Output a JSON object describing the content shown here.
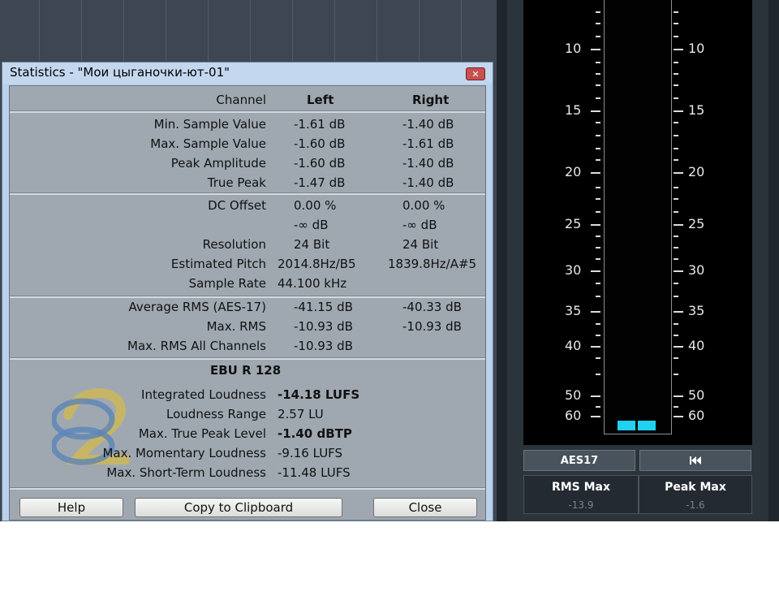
{
  "dialog": {
    "title": "Statistics - \"Мои цыганочки-ют-01\"",
    "close_icon": "close-x-icon",
    "header": {
      "channel": "Channel",
      "left": "Left",
      "right": "Right"
    },
    "peak_section": [
      {
        "label": "Min. Sample Value",
        "left": "-1.61 dB",
        "right": "-1.40 dB"
      },
      {
        "label": "Max. Sample Value",
        "left": "-1.60 dB",
        "right": "-1.61 dB"
      },
      {
        "label": "Peak Amplitude",
        "left": "-1.60 dB",
        "right": "-1.40 dB"
      },
      {
        "label": "True Peak",
        "left": "-1.47 dB",
        "right": "-1.40 dB"
      }
    ],
    "dc_section": [
      {
        "label": "DC Offset",
        "left": "0.00 %",
        "right": "0.00 %"
      },
      {
        "label": "",
        "left": "-∞ dB",
        "right": "-∞ dB"
      },
      {
        "label": "Resolution",
        "left": "24 Bit",
        "right": "24 Bit"
      },
      {
        "label": "Estimated Pitch",
        "left": "2014.8Hz/B5",
        "right": "1839.8Hz/A#5"
      },
      {
        "label": "Sample Rate",
        "left": "44.100 kHz",
        "right": ""
      }
    ],
    "rms_section": [
      {
        "label": "Average RMS (AES-17)",
        "left": "-41.15 dB",
        "right": "-40.33 dB"
      },
      {
        "label": "Max. RMS",
        "left": "-10.93 dB",
        "right": "-10.93 dB"
      },
      {
        "label": "Max. RMS All Channels",
        "left": "-10.93 dB",
        "right": ""
      }
    ],
    "ebu_heading": "EBU R 128",
    "ebu_section": [
      {
        "label": "Integrated Loudness",
        "value": "-14.18 LUFS",
        "bold": true
      },
      {
        "label": "Loudness Range",
        "value": "2.57 LU",
        "bold": false
      },
      {
        "label": "Max. True Peak Level",
        "value": "-1.40 dBTP",
        "bold": true
      },
      {
        "label": "Max. Momentary Loudness",
        "value": "-9.16 LUFS",
        "bold": false
      },
      {
        "label": "Max. Short-Term Loudness",
        "value": "-11.48 LUFS",
        "bold": false
      }
    ],
    "buttons": {
      "help": "Help",
      "copy": "Copy to Clipboard",
      "close": "Close"
    }
  },
  "meter": {
    "scale_left": [
      "10",
      "15",
      "20",
      "25",
      "30",
      "35",
      "40",
      "50",
      "60"
    ],
    "scale_right": [
      "10",
      "15",
      "20",
      "25",
      "30",
      "35",
      "40",
      "50",
      "60"
    ],
    "aes_button": "AES17",
    "reset_icon": "skip-to-start-icon",
    "rms_max_label": "RMS Max",
    "rms_max_value": "-13.9",
    "peak_max_label": "Peak Max",
    "peak_max_value": "-1.6",
    "level_color": "#1fd2f0"
  }
}
